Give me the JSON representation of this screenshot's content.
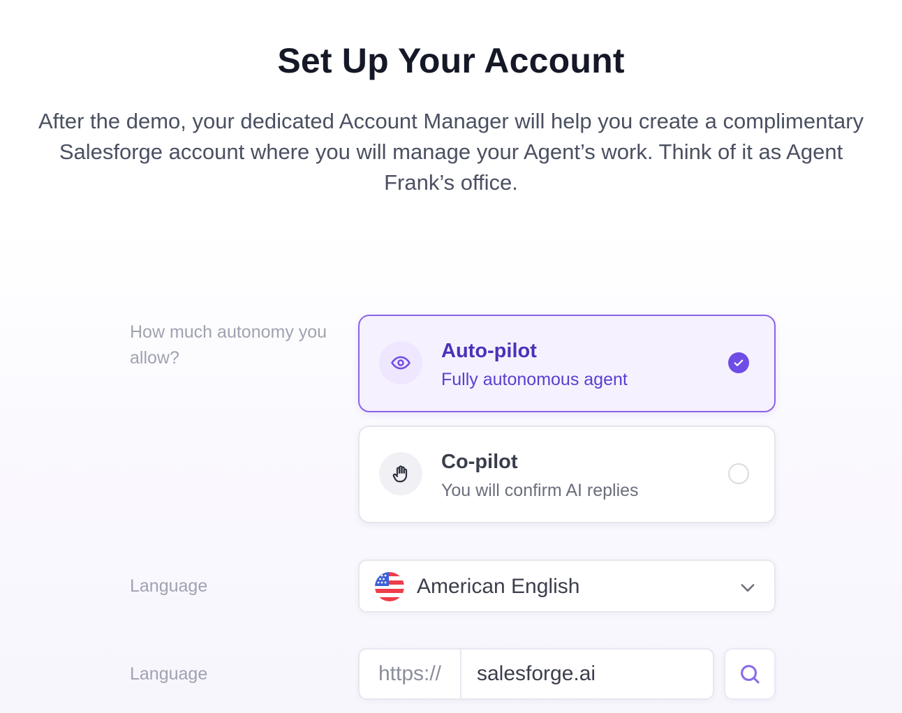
{
  "header": {
    "title": "Set Up Your Account",
    "subtitle": "After the demo, your dedicated Account Manager will help you create a complimentary Salesforge account where you will manage your Agent’s work. Think of it as Agent Frank’s office."
  },
  "autonomy": {
    "label": "How much autonomy you allow?",
    "options": [
      {
        "title": "Auto-pilot",
        "description": "Fully autonomous agent",
        "icon": "eye-icon",
        "selected": true
      },
      {
        "title": "Co-pilot",
        "description": "You will confirm AI replies",
        "icon": "hand-icon",
        "selected": false
      }
    ]
  },
  "language": {
    "label": "Language",
    "selected_value": "American English",
    "flag_icon": "us-flag-icon",
    "dropdown_icon": "chevron-down-icon"
  },
  "domain": {
    "label": "Language",
    "prefix": "https://",
    "value": "salesforge.ai",
    "search_icon": "search-icon"
  },
  "colors": {
    "accent": "#6f4ce6",
    "accent_text": "#4b32b8",
    "selected_border": "#8b63e6",
    "selected_bg": "#f6f1ff"
  }
}
